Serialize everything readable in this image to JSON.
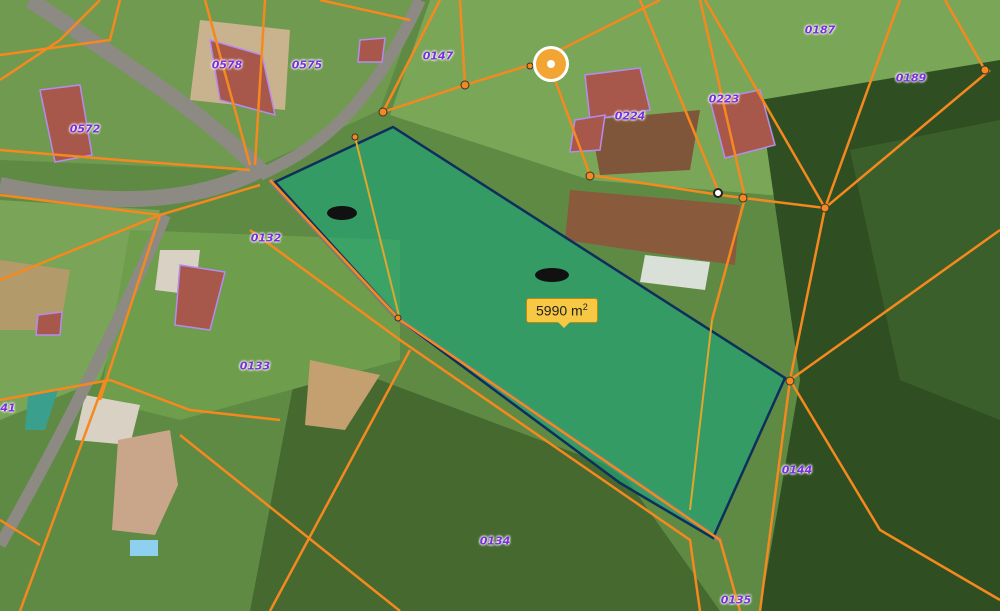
{
  "map": {
    "area_measurement": {
      "value": "5990 m",
      "unit_sup": "2"
    },
    "parcel_labels": [
      "0578",
      "0575",
      "0147",
      "0187",
      "0189",
      "0572",
      "0224",
      "0223",
      "0132",
      "0133",
      "0144",
      "0134",
      "0135",
      "41"
    ],
    "colors": {
      "parcel_line": "#f5891f",
      "selection_fill": "#1aa67a",
      "selection_border": "#0e2f5c",
      "building_outline": "#b48cf0",
      "label": "#7a2ee0"
    },
    "marker_icon": "location-marker-icon"
  }
}
